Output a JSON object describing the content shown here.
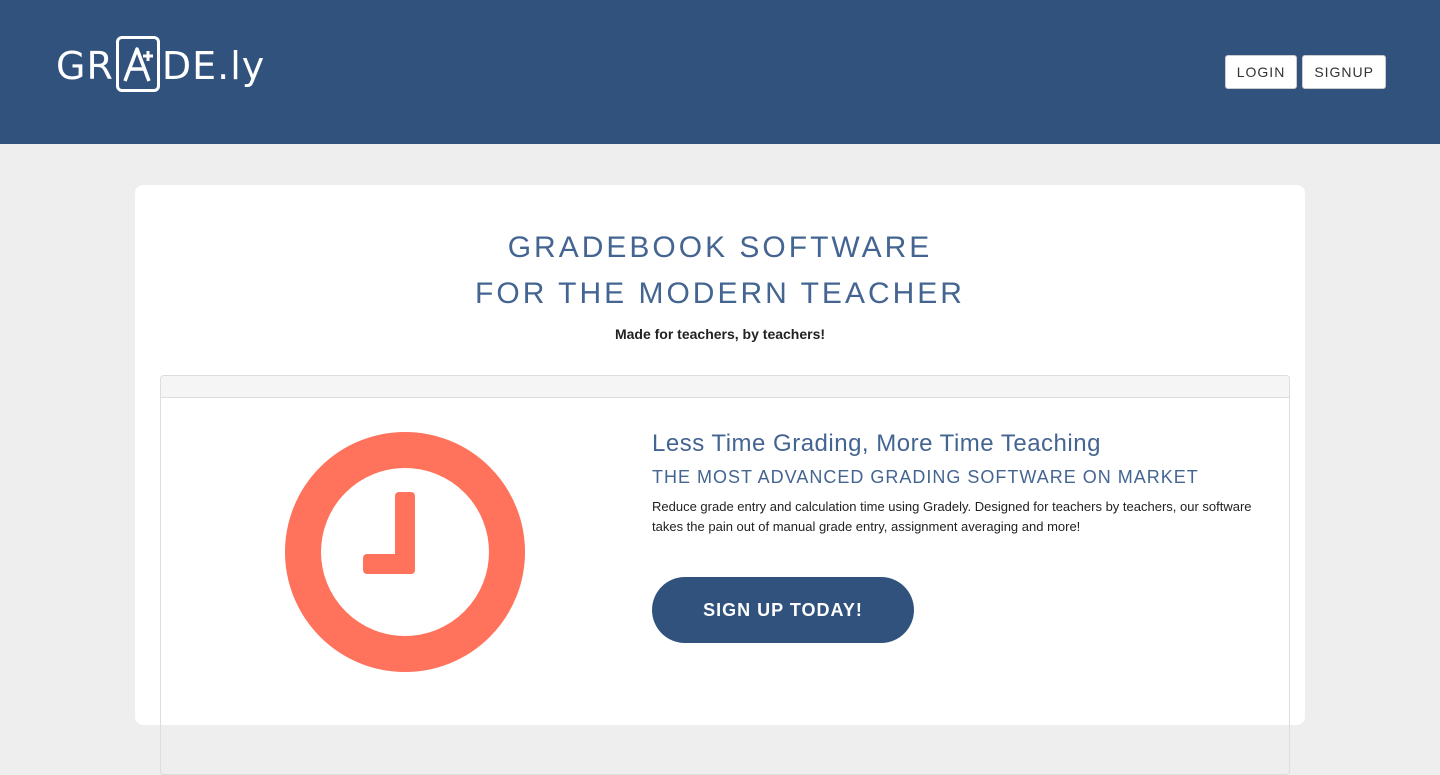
{
  "brand": {
    "logo_prefix": "GR",
    "logo_suffix": "DE.ly"
  },
  "nav": {
    "login_label": "LOGIN",
    "signup_label": "SIGNUP"
  },
  "hero": {
    "headline_line1": "GRADEBOOK SOFTWARE",
    "headline_line2": "FOR THE MODERN TEACHER",
    "tagline": "Made for teachers, by teachers!"
  },
  "feature": {
    "icon": "clock-icon",
    "title": "Less Time Grading, More Time Teaching",
    "subtitle": "THE MOST ADVANCED GRADING SOFTWARE ON MARKET",
    "description": "Reduce grade entry and calculation time using Gradely. Designed for teachers by teachers, our software takes the pain out of manual grade entry, assignment averaging and more!",
    "cta_label": "SIGN UP TODAY!"
  },
  "colors": {
    "header_bg": "#30527c",
    "accent_text": "#446591",
    "clock": "#ff725c",
    "page_bg": "#eeeeee"
  }
}
